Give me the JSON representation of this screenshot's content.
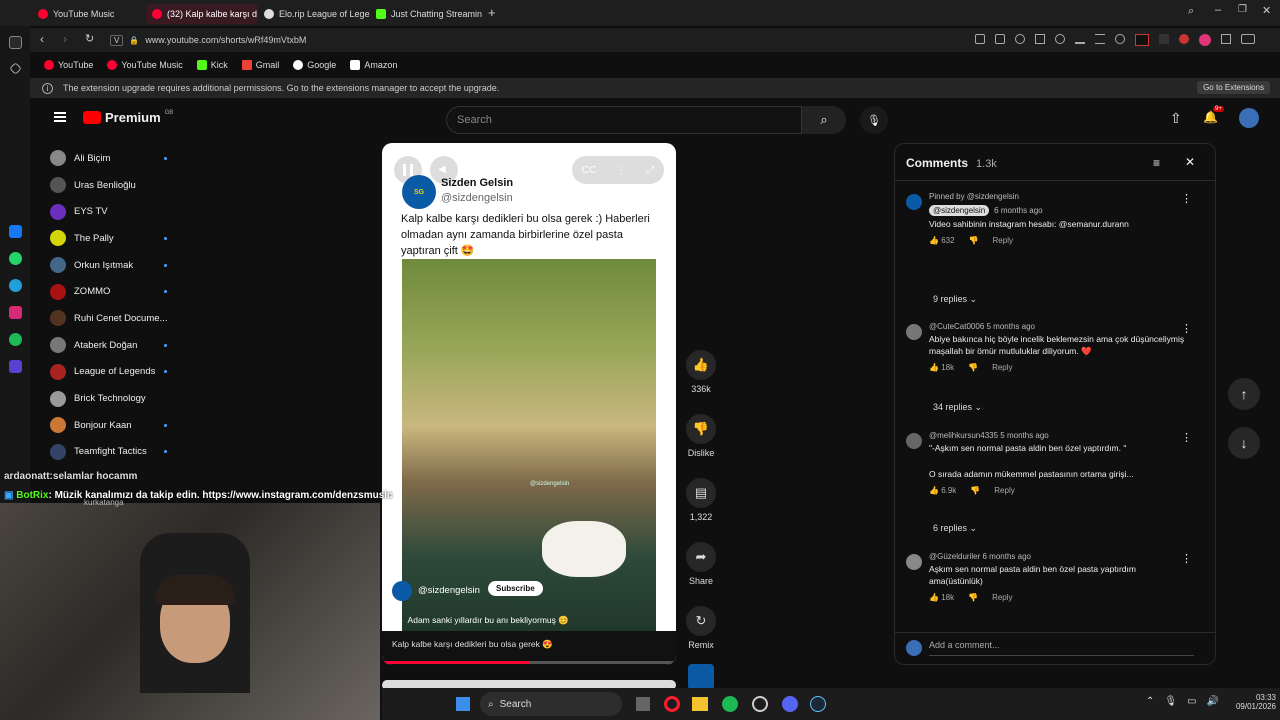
{
  "tabs": [
    {
      "label": "YouTube Music",
      "color": "#ff0033"
    },
    {
      "label": "(32) Kalp kalbe karşı d",
      "color": "#ff0033"
    },
    {
      "label": "Elo.rip League of Legend:",
      "color": "#dddddd"
    },
    {
      "label": "Just Chatting Streaming -",
      "color": "#53fc18"
    }
  ],
  "url": "www.youtube.com/shorts/wRf49mVtxbM",
  "url_prefix": "V",
  "bookmarks": [
    "YouTube",
    "YouTube Music",
    "Kick",
    "Gmail",
    "Google",
    "Amazon"
  ],
  "notice": {
    "text": "The extension upgrade requires additional permissions. Go to the extensions manager to accept the upgrade.",
    "button": "Go to Extensions"
  },
  "yt": {
    "logo": "Premium",
    "region": "GB",
    "search_placeholder": "Search",
    "notif_badge": "9+"
  },
  "subscriptions": [
    {
      "name": "Ali Biçim",
      "color": "#888",
      "dot": true
    },
    {
      "name": "Uras Benlioğlu",
      "color": "#555",
      "dot": false
    },
    {
      "name": "EYS TV",
      "color": "#6a2fbf",
      "dot": false
    },
    {
      "name": "The Pally",
      "color": "#d4d40a",
      "dot": true
    },
    {
      "name": "Orkun Işıtmak",
      "color": "#446688",
      "dot": true
    },
    {
      "name": "ZOMMO",
      "color": "#aa1111",
      "dot": true
    },
    {
      "name": "Ruhi Cenet Docume...",
      "color": "#553322",
      "dot": false
    },
    {
      "name": "Ataberk Doğan",
      "color": "#777",
      "dot": true
    },
    {
      "name": "League of Legends",
      "color": "#aa2222",
      "dot": true
    },
    {
      "name": "Brick Technology",
      "color": "#999",
      "dot": false
    },
    {
      "name": "Bonjour Kaan",
      "color": "#cc7733",
      "dot": true
    },
    {
      "name": "Teamfight Tactics",
      "color": "#334466",
      "dot": true
    }
  ],
  "short": {
    "channel": "Sizden Gelsin",
    "handle": "@sizdengelsin",
    "caption": "Kalp kalbe karşı dedikleri bu olsa gerek :) Haberleri olmadan aynı zamanda birbirlerine özel pasta yaptıran çift 🤩",
    "overlay_handle": "@sizdengelsin",
    "subscribe": "Subscribe",
    "song": "Adam sanki yıllardır bu anı bekliyormuş 😊",
    "title": "Kalp kalbe karşı dedikleri bu olsa gerek 😍",
    "progress": 0.5
  },
  "actions": {
    "likes": "336k",
    "dislike": "Dislike",
    "comments": "1,322",
    "share": "Share",
    "remix": "Remix"
  },
  "comments_panel": {
    "title": "Comments",
    "count": "1.3k",
    "items": [
      {
        "pinned": "Pinned by @sizdengelsin",
        "author": "@sizdengelsin",
        "time": "6 months ago",
        "text": "Video sahibinin instagram hesabı: @semanur.durann",
        "likes": "632",
        "reply": "Reply",
        "replies": "9 replies"
      },
      {
        "author": "@CuteCat0006",
        "time": "5 months ago",
        "text": "Abiye bakınca hiç böyle incelik beklemezsin ama çok düşünceliymiş maşallah bir ömür mutluluklar diliyorum. ❤️",
        "likes": "18k",
        "reply": "Reply",
        "replies": "34 replies"
      },
      {
        "author": "@melihkursun4335",
        "time": "5 months ago",
        "text": "\"-Aşkım sen normal pasta aldin ben özel yaptırdım. \"",
        "text2": "O sırada adamın mükemmel pastasının ortama girişi...",
        "likes": "6.9k",
        "reply": "Reply",
        "replies": "6 replies"
      },
      {
        "author": "@Güzelduriler",
        "time": "6 months ago",
        "text": "Aşkım sen normal pasta aldin ben özel pasta yaptırdım ama(üstünlük)",
        "likes": "18k",
        "reply": "Reply"
      }
    ],
    "add_placeholder": "Add a comment..."
  },
  "chat": {
    "line1_user": "ardaonatt:",
    "line1_text": "selamlar hocamm",
    "line2_user": "BotRix",
    "line2_text": ": Müzik kanalımızı da takip edin. https://www.instagram.com/denzsmusic",
    "sub_partial": "kurkatanga"
  },
  "taskbar": {
    "search": "Search",
    "time": "03:33",
    "date": "09/01/2026"
  }
}
